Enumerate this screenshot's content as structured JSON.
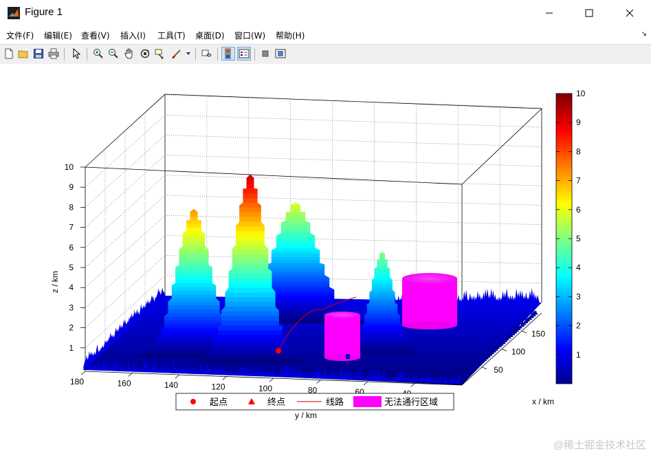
{
  "window": {
    "title": "Figure 1",
    "minimize_icon": "minimize-icon",
    "maximize_icon": "maximize-icon",
    "close_icon": "close-icon"
  },
  "menu": {
    "items": [
      "文件(F)",
      "编辑(E)",
      "查看(V)",
      "插入(I)",
      "工具(T)",
      "桌面(D)",
      "窗口(W)",
      "帮助(H)"
    ]
  },
  "toolbar": {
    "icons": [
      "new-figure-icon",
      "open-file-icon",
      "save-icon",
      "print-icon",
      "select-arrow-icon",
      "zoom-in-icon",
      "zoom-out-icon",
      "pan-hand-icon",
      "rotate-3d-icon",
      "data-cursor-icon",
      "brush-icon",
      "link-plot-icon",
      "colorbar-icon",
      "legend-icon",
      "hide-plot-tools-icon",
      "show-plot-tools-icon"
    ]
  },
  "chart_data": {
    "type": "surface",
    "title": "",
    "xlabel": "x / km",
    "ylabel": "y / km",
    "zlabel": "z / km",
    "x_ticks": [
      "50",
      "100",
      "150"
    ],
    "y_ticks": [
      "180",
      "160",
      "140",
      "120",
      "100",
      "80",
      "60",
      "40"
    ],
    "z_ticks": [
      "1",
      "2",
      "3",
      "4",
      "5",
      "6",
      "7",
      "8",
      "9",
      "10"
    ],
    "zlim": [
      0,
      10
    ],
    "colormap": "jet",
    "colorbar_ticks": [
      "1",
      "2",
      "3",
      "4",
      "5",
      "6",
      "7",
      "8",
      "9",
      "10"
    ],
    "colorbar_range": [
      0,
      10
    ],
    "grid": true,
    "peaks_approx_height": [
      7.4,
      9.4,
      6.0,
      5.1
    ],
    "legend": {
      "placement": "bottom",
      "entries": [
        {
          "label": "起点",
          "marker": "circle",
          "color": "#ff0000"
        },
        {
          "label": "终点",
          "marker": "triangle",
          "color": "#ff0000"
        },
        {
          "label": "线路",
          "marker": "line",
          "color": "#ff0000"
        },
        {
          "label": "无法通行区域",
          "marker": "patch",
          "color": "#ff00ff"
        }
      ]
    }
  },
  "watermark": "@稀土掘金技术社区"
}
